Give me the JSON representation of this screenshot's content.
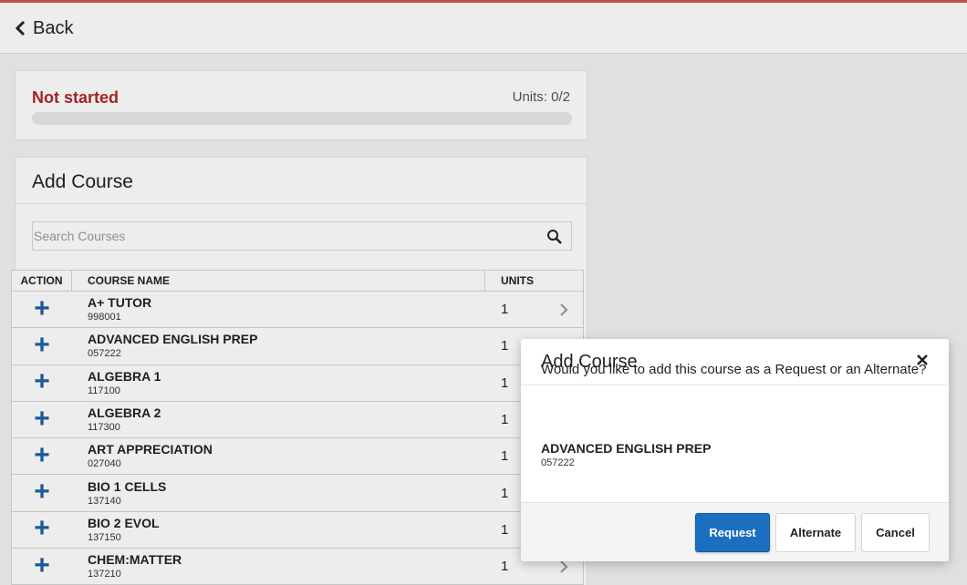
{
  "header": {
    "back_label": "Back"
  },
  "status": {
    "label": "Not started",
    "units": "Units: 0/2",
    "progress": 0
  },
  "add_course": {
    "title": "Add Course",
    "search_placeholder": "Search Courses",
    "columns": {
      "action": "ACTION",
      "name": "COURSE NAME",
      "units": "UNITS"
    },
    "rows": [
      {
        "name": "A+ TUTOR",
        "number": "998001",
        "units": "1"
      },
      {
        "name": "ADVANCED ENGLISH PREP",
        "number": "057222",
        "units": "1"
      },
      {
        "name": "ALGEBRA 1",
        "number": "117100",
        "units": "1"
      },
      {
        "name": "ALGEBRA 2",
        "number": "117300",
        "units": "1"
      },
      {
        "name": "ART APPRECIATION",
        "number": "027040",
        "units": "1"
      },
      {
        "name": "BIO 1 CELLS",
        "number": "137140",
        "units": "1"
      },
      {
        "name": "BIO 2 EVOL",
        "number": "137150",
        "units": "1"
      },
      {
        "name": "CHEM:MATTER",
        "number": "137210",
        "units": "1"
      }
    ]
  },
  "modal": {
    "title": "Add Course",
    "question": "Would you like to add this course as a Request or an Alternate?",
    "course_name": "ADVANCED ENGLISH PREP",
    "course_number": "057222",
    "request_label": "Request",
    "alternate_label": "Alternate",
    "cancel_label": "Cancel"
  },
  "colors": {
    "accent": "#1a6fc0",
    "status": "#b0272d",
    "plus": "#1f5fa6"
  }
}
